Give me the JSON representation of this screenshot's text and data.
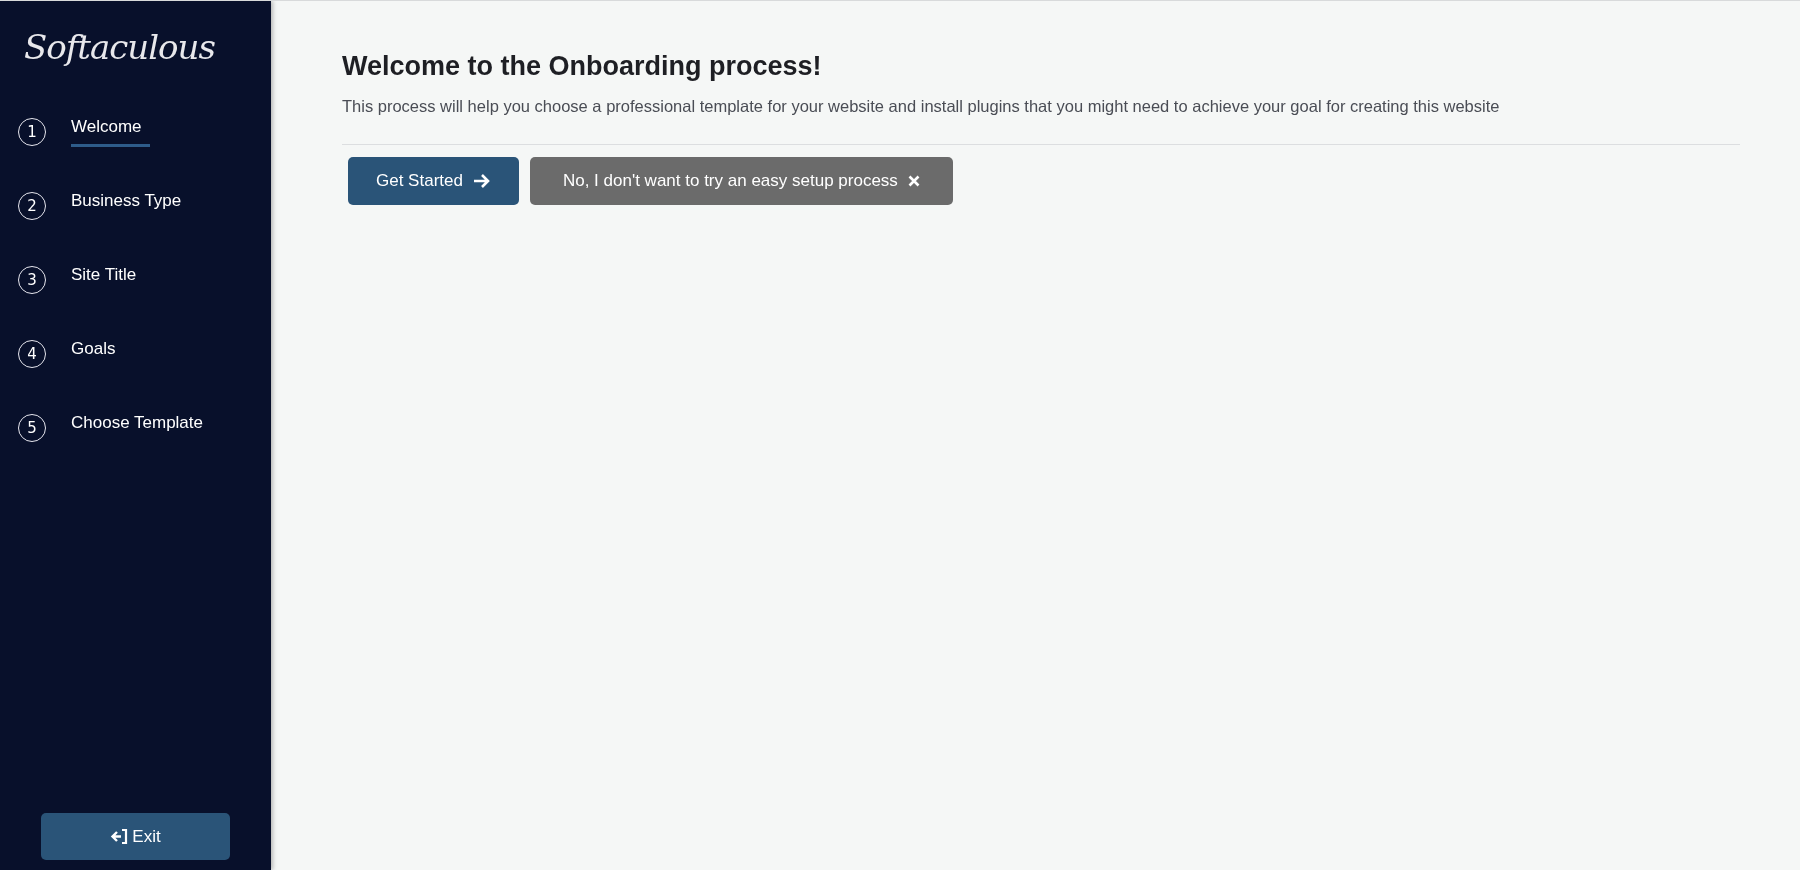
{
  "sidebar": {
    "logo": "Softaculous",
    "steps": [
      {
        "number": "1",
        "label": "Welcome",
        "selected": true
      },
      {
        "number": "2",
        "label": "Business Type",
        "selected": false
      },
      {
        "number": "3",
        "label": "Site Title",
        "selected": false
      },
      {
        "number": "4",
        "label": "Goals",
        "selected": false
      },
      {
        "number": "5",
        "label": "Choose Template",
        "selected": false
      }
    ],
    "exit_button": "Exit"
  },
  "main": {
    "title": "Welcome to the Onboarding process!",
    "description": "This process will help you choose a professional template for your website and install plugins that you might need to achieve your goal for creating this website",
    "buttons": [
      {
        "kind": "primary",
        "label": "Get Started"
      },
      {
        "kind": "secondary",
        "label": "No, I don't want to try an easy setup process"
      }
    ]
  }
}
